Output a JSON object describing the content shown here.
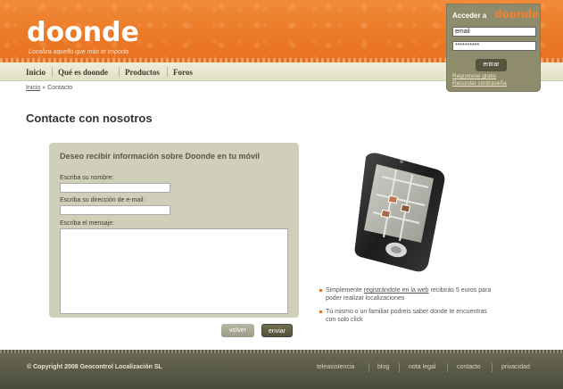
{
  "header": {
    "logo": "doonde",
    "tagline": "Localiza aquello que más te importa"
  },
  "nav": {
    "items": [
      "Inicio",
      "Qué es doonde",
      "Productos",
      "Foros"
    ]
  },
  "breadcrumb": {
    "home": "Inicio",
    "separator": "»",
    "current": "Contacto"
  },
  "login": {
    "title": "Acceder a",
    "logo": "doonde",
    "email_value": "email",
    "password_value": "**********",
    "submit_label": "entrar",
    "register_link": "Regístrese gratis",
    "recover_link": "Recordar contraseña"
  },
  "page": {
    "title": "Contacte con nosotros"
  },
  "form": {
    "heading": "Deseo recibir información sobre Doonde en tu móvil",
    "name_label": "Escriba su nombre:",
    "email_label": "Escriba su dirección de e-mail:",
    "message_label": "Escriba el mensaje:",
    "back_label": "volver",
    "send_label": "enviar"
  },
  "info": {
    "bullet1_pre": "Simplemente ",
    "bullet1_link": "registrándote en la web",
    "bullet1_post": " recibirás 5 euros para poder realizar localizaciones",
    "bullet2": "Tú mismo o un familiar podreis saber donde te encuentras con solo click"
  },
  "footer": {
    "copyright": "© Copyright 2008 Geocontrol Localización SL",
    "links": [
      "teleasistencia",
      "blog",
      "nota legal",
      "contacto",
      "privacidad"
    ]
  },
  "colors": {
    "brand_orange": "#ec7a26",
    "olive_panel": "#cfcfba",
    "olive_dark": "#55543d",
    "footer_bg": "#4b4b3c"
  },
  "icons": [
    "phone-illustration-icon",
    "bullet-square-icon"
  ]
}
